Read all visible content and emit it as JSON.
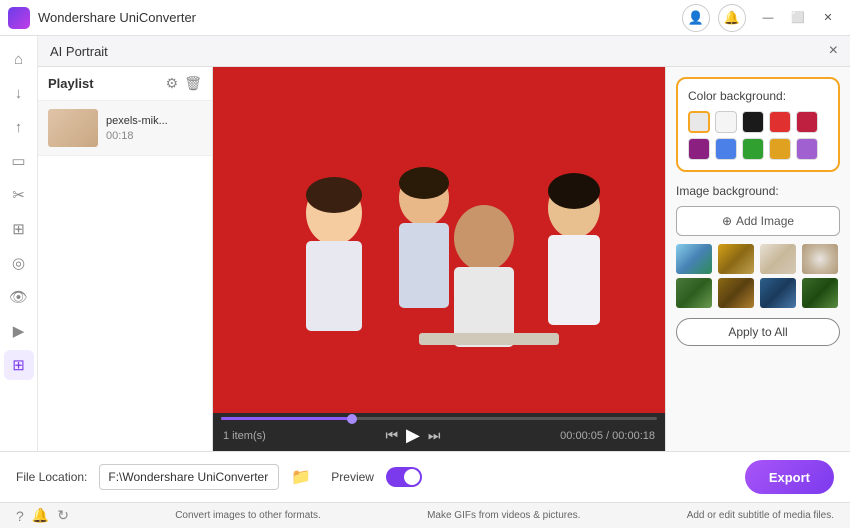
{
  "titlebar": {
    "app_name": "Wondershare UniConverter",
    "account_icon": "👤",
    "notification_icon": "🔔"
  },
  "panel": {
    "title": "AI Portrait",
    "close_label": "×"
  },
  "playlist": {
    "title": "Playlist",
    "items": [
      {
        "name": "pexels-mik...",
        "duration": "00:18"
      }
    ],
    "count": "1 item(s)"
  },
  "video": {
    "current_time": "00:00:05",
    "total_time": "00:00:18",
    "progress_percent": 30
  },
  "color_background": {
    "label": "Color background:",
    "colors": [
      {
        "value": "#e8e8e8",
        "name": "light-gray"
      },
      {
        "value": "#f5f5f5",
        "name": "white"
      },
      {
        "value": "#1a1a1a",
        "name": "black"
      },
      {
        "value": "#e03030",
        "name": "red"
      },
      {
        "value": "#c0203a",
        "name": "dark-red"
      },
      {
        "value": "#8b2080",
        "name": "purple"
      },
      {
        "value": "#4a80e8",
        "name": "blue"
      },
      {
        "value": "#30a030",
        "name": "green"
      },
      {
        "value": "#e0a020",
        "name": "orange"
      },
      {
        "value": "#a060d0",
        "name": "violet"
      }
    ]
  },
  "image_background": {
    "label": "Image background:",
    "add_button": "Add Image",
    "thumbnails": [
      "nature-outdoor",
      "desert-sand",
      "interior-room",
      "texture-neutral",
      "forest-green",
      "wood-brown",
      "ocean-blue",
      "jungle-dark"
    ]
  },
  "apply_all": {
    "label": "Apply to All"
  },
  "bottom_bar": {
    "file_location_label": "File Location:",
    "file_path": "F:\\Wondershare UniConverter",
    "preview_label": "Preview",
    "export_label": "Export"
  },
  "feature_bar": {
    "items": [
      "Convert images to other formats.",
      "Make GIFs from videos & pictures.",
      "Add or edit subtitle of media files."
    ]
  },
  "sidebar_icons": [
    "home",
    "download",
    "upload",
    "screen",
    "scissors",
    "grid",
    "target",
    "eye",
    "video",
    "apps"
  ]
}
